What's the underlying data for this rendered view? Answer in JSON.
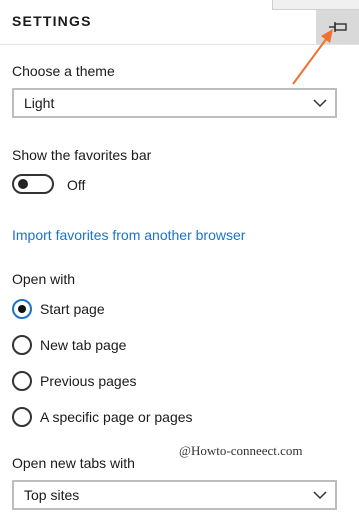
{
  "header": {
    "title": "SETTINGS"
  },
  "theme": {
    "label": "Choose a theme",
    "value": "Light"
  },
  "favorites_bar": {
    "label": "Show the favorites bar",
    "state": "Off"
  },
  "import_link": "Import favorites from another browser",
  "open_with": {
    "label": "Open with",
    "options": [
      "Start page",
      "New tab page",
      "Previous pages",
      "A specific page or pages"
    ],
    "selected": "Start page"
  },
  "watermark": "@Howto-conneect.com",
  "new_tabs": {
    "label": "Open new tabs with",
    "value": "Top sites"
  },
  "colors": {
    "accent": "#1a73c9",
    "arrow": "#f07030"
  }
}
